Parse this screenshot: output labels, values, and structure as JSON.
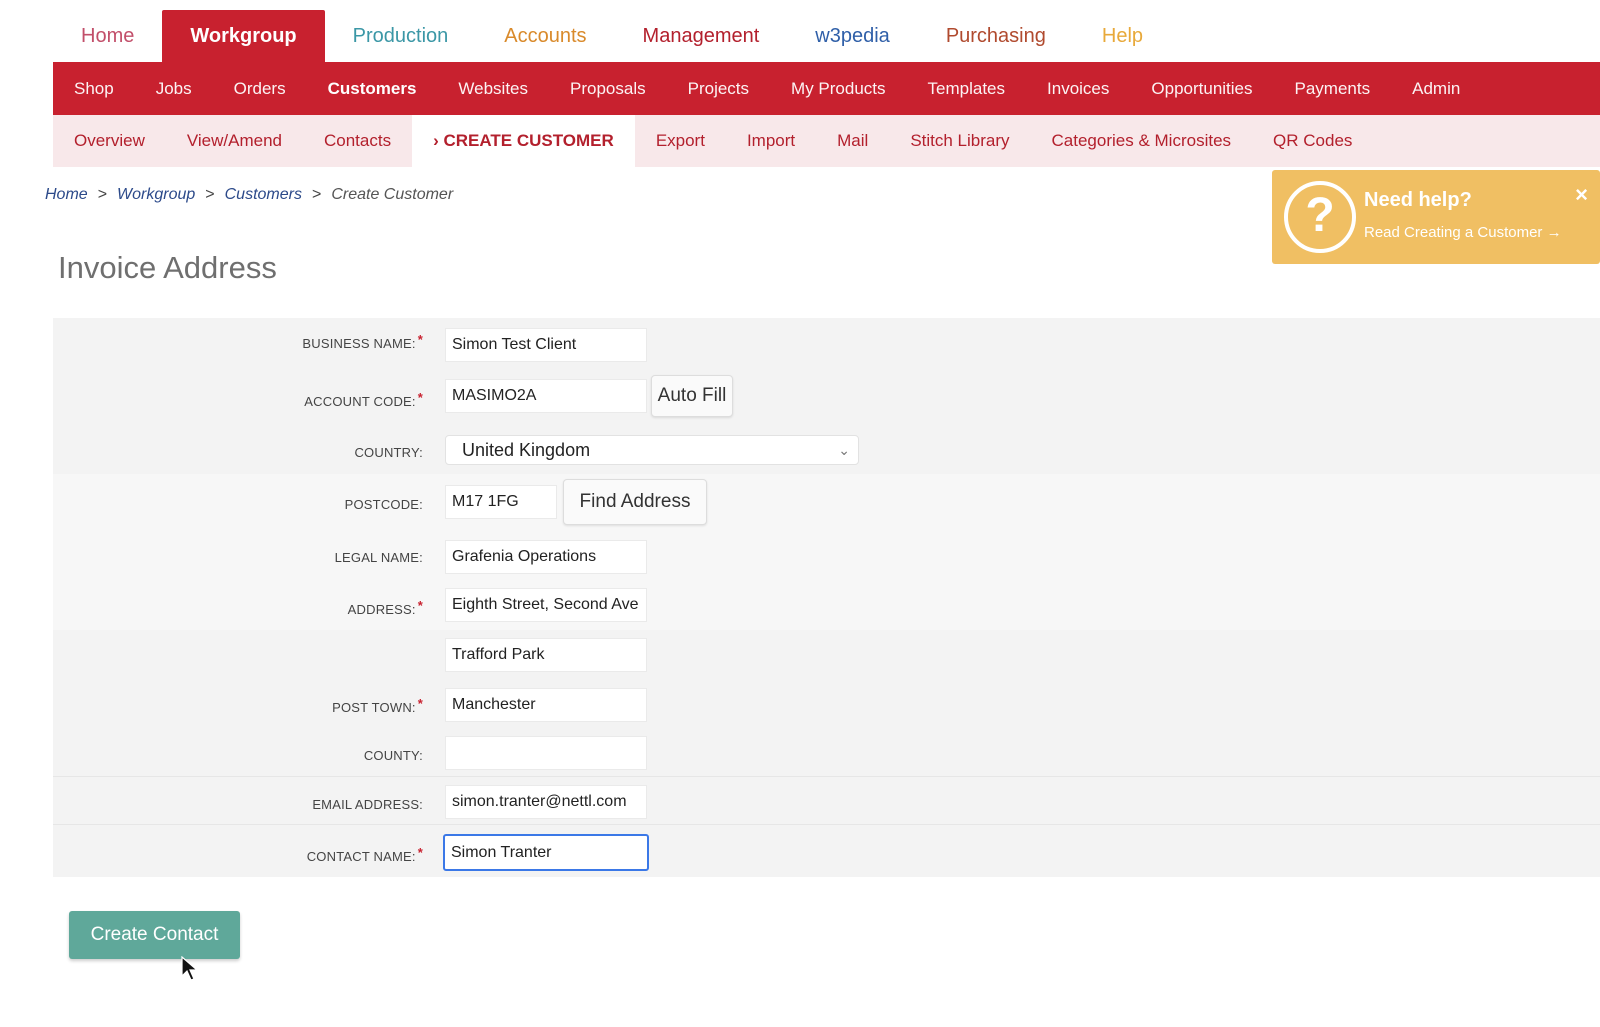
{
  "top_nav": [
    {
      "label": "Home",
      "color": "#c24f6a"
    },
    {
      "label": "Workgroup",
      "color": "#ffffff"
    },
    {
      "label": "Production",
      "color": "#3b97a6"
    },
    {
      "label": "Accounts",
      "color": "#d98a2b"
    },
    {
      "label": "Management",
      "color": "#b3202d"
    },
    {
      "label": "w3pedia",
      "color": "#2f5fa8"
    },
    {
      "label": "Purchasing",
      "color": "#b04a2e"
    },
    {
      "label": "Help",
      "color": "#e8a93a"
    }
  ],
  "sub_nav": [
    "Shop",
    "Jobs",
    "Orders",
    "Customers",
    "Websites",
    "Proposals",
    "Projects",
    "My Products",
    "Templates",
    "Invoices",
    "Opportunities",
    "Payments",
    "Admin"
  ],
  "third_nav": [
    "Overview",
    "View/Amend",
    "Contacts",
    "› Create Customer",
    "Export",
    "Import",
    "Mail",
    "Stitch Library",
    "Categories & Microsites",
    "QR Codes"
  ],
  "breadcrumb": {
    "home": "Home",
    "workgroup": "Workgroup",
    "customers": "Customers",
    "current": "Create Customer",
    "sep": ">"
  },
  "help": {
    "title": "Need help?",
    "link": "Read Creating a Customer →",
    "icon": "?",
    "close": "×"
  },
  "section_title": "Invoice Address",
  "form": {
    "business_name": {
      "label": "Business Name:",
      "value": "Simon Test Client"
    },
    "account_code": {
      "label": "Account Code:",
      "value": "MASIMO2A",
      "button": "Auto Fill"
    },
    "country": {
      "label": "Country:",
      "value": "United Kingdom"
    },
    "postcode": {
      "label": "Postcode:",
      "value": "M17 1FG",
      "button": "Find Address"
    },
    "legal_name": {
      "label": "Legal Name:",
      "value": "Grafenia Operations"
    },
    "address": {
      "label": "Address:",
      "value": "Eighth Street, Second Ave"
    },
    "address2": {
      "value": "Trafford Park"
    },
    "post_town": {
      "label": "Post Town:",
      "value": "Manchester"
    },
    "county": {
      "label": "County:",
      "value": ""
    },
    "email": {
      "label": "Email Address:",
      "value": "simon.tranter@nettl.com"
    },
    "contact_name": {
      "label": "Contact Name:",
      "value": "Simon Tranter"
    }
  },
  "create_button": "Create Contact",
  "required_marker": "*",
  "colors": {
    "brand_red": "#c8212f",
    "tab_pink": "#f8e8ea",
    "help_orange": "#f0bf63",
    "button_teal": "#5fa89a"
  }
}
